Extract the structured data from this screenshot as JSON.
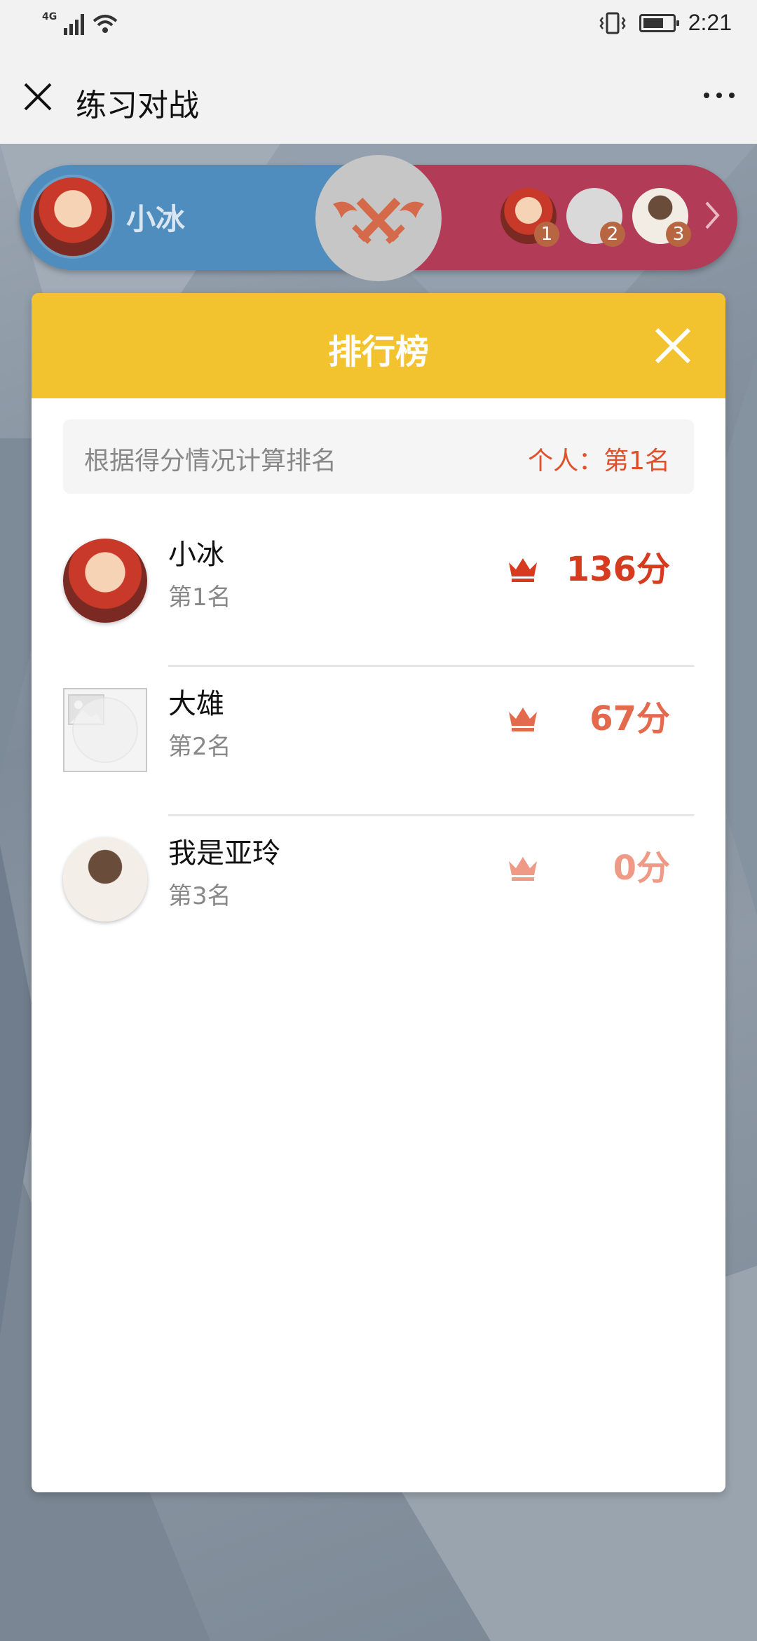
{
  "status_bar": {
    "signal_label": "4G",
    "time": "2:21"
  },
  "header": {
    "title": "练习对战"
  },
  "battle": {
    "my_name": "小冰",
    "opponents": [
      {
        "rank": "1"
      },
      {
        "rank": "2"
      },
      {
        "rank": "3"
      }
    ]
  },
  "leaderboard": {
    "title": "排行榜",
    "info_text": "根据得分情况计算排名",
    "my_rank": "个人：第1名",
    "entries": [
      {
        "name": "小冰",
        "rank": "第1名",
        "score": "136分",
        "color": "#d63b1f"
      },
      {
        "name": "大雄",
        "rank": "第2名",
        "score": "67分",
        "color": "#e46a4e"
      },
      {
        "name": "我是亚玲",
        "rank": "第3名",
        "score": "0分",
        "color": "#ee9a86"
      }
    ]
  },
  "colors": {
    "header_yellow": "#f2c32e",
    "battle_blue": "#4e8dbd",
    "battle_red": "#b23b58",
    "accent_orange": "#e0502a"
  }
}
